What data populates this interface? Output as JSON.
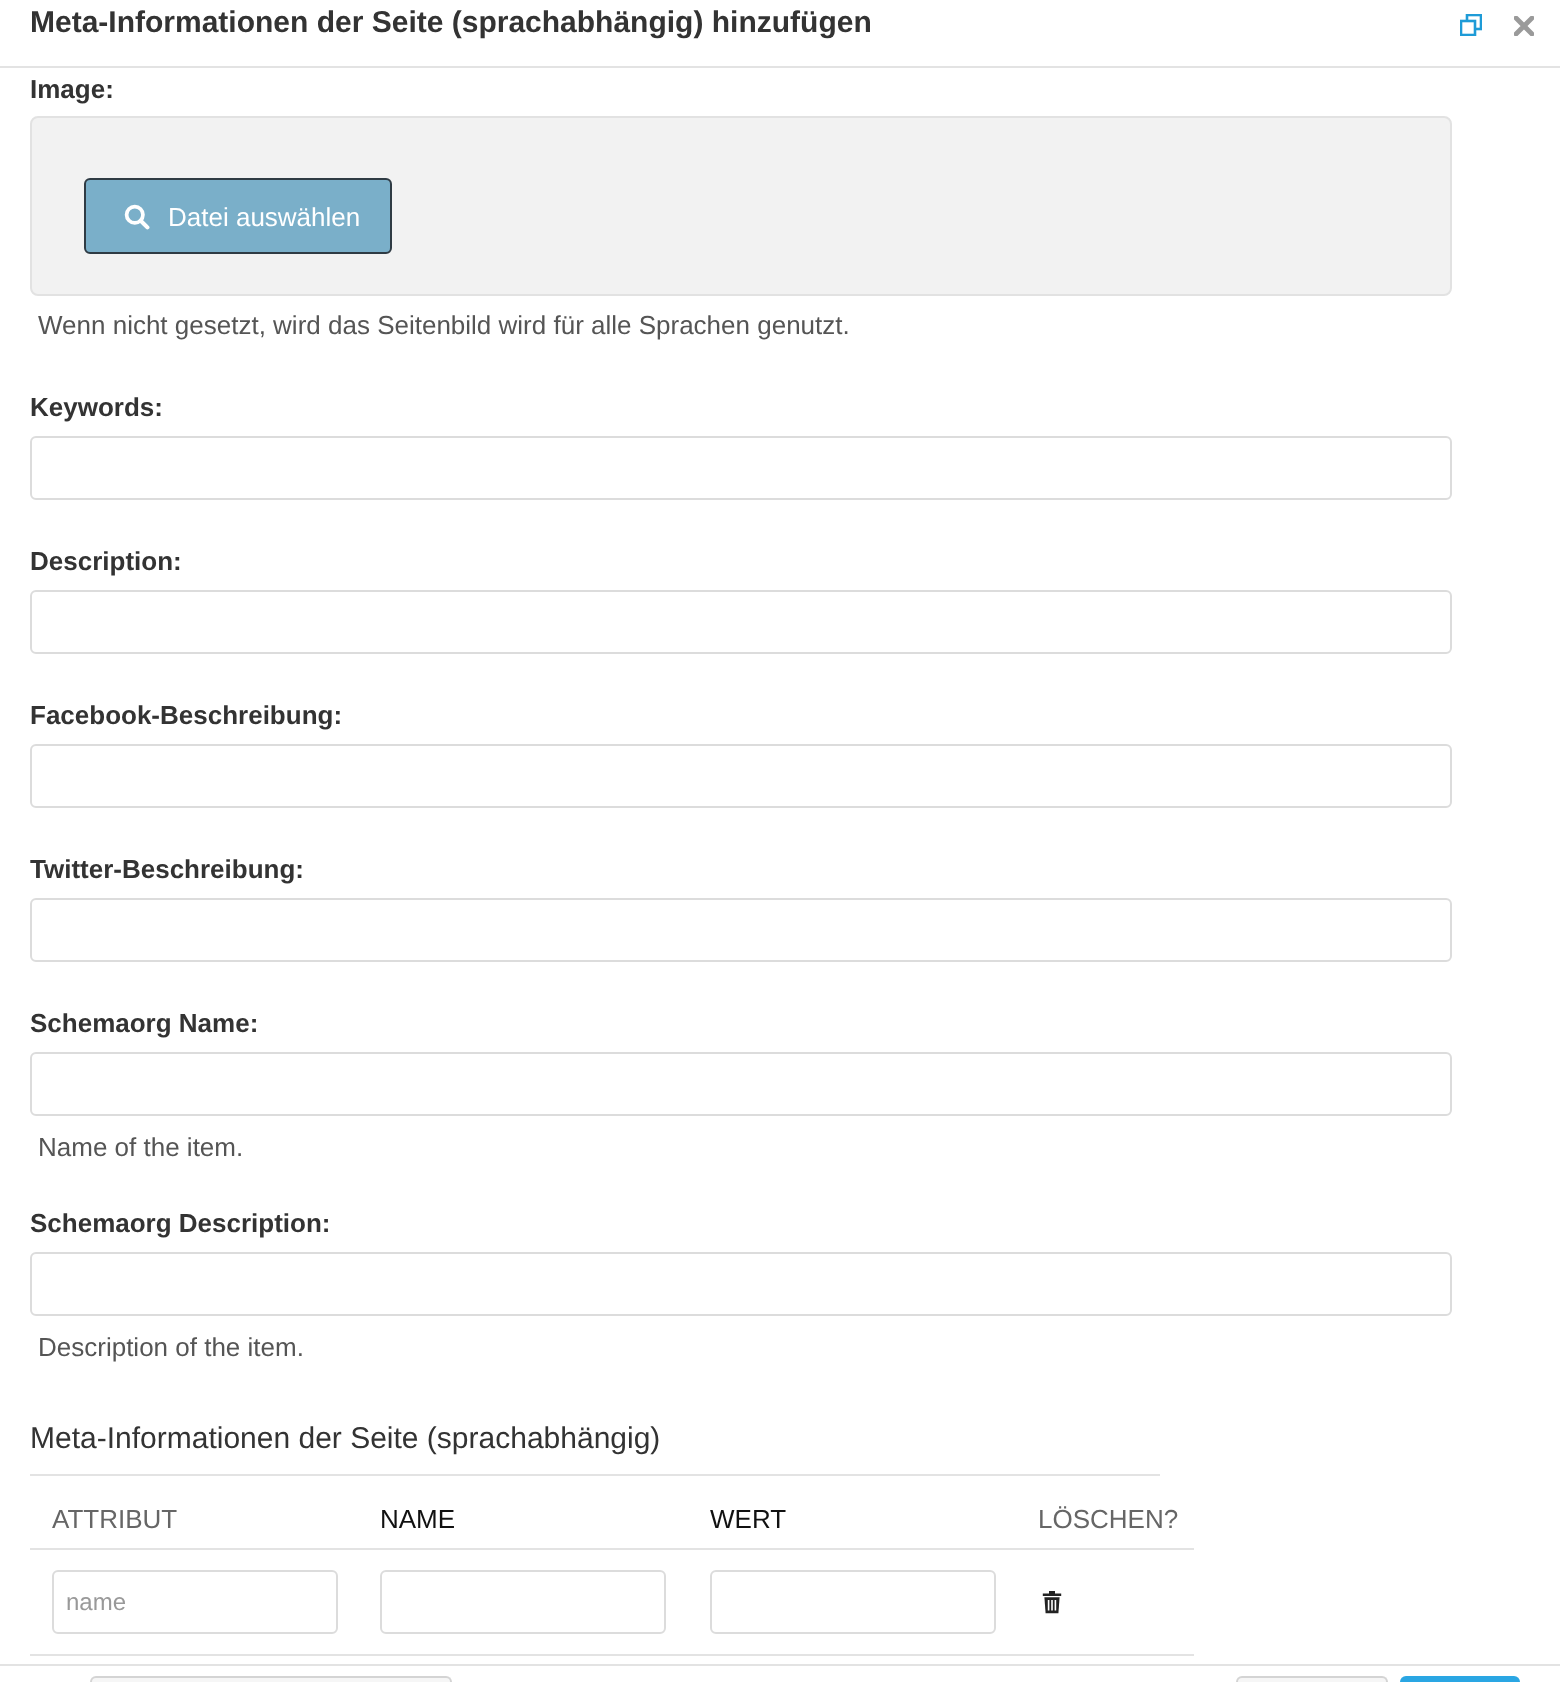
{
  "dialog": {
    "title": "Meta-Informationen der Seite (sprachabhängig) hinzufügen"
  },
  "fields": [
    {
      "kind": "image",
      "label": "Image:",
      "button": "Datei auswählen",
      "help": "Wenn nicht gesetzt, wird das Seitenbild wird für alle Sprachen genutzt."
    },
    {
      "kind": "text",
      "label": "Keywords:"
    },
    {
      "kind": "text",
      "label": "Description:"
    },
    {
      "kind": "text",
      "label": "Facebook-Beschreibung:"
    },
    {
      "kind": "text",
      "label": "Twitter-Beschreibung:"
    },
    {
      "kind": "text",
      "label": "Schemaorg Name:",
      "help": "Name of the item."
    },
    {
      "kind": "text",
      "label": "Schemaorg Description:",
      "help": "Description of the item."
    }
  ],
  "meta_table": {
    "heading": "Meta-Informationen der Seite (sprachabhängig)",
    "columns": [
      {
        "label": "ATTRIBUT",
        "muted": true
      },
      {
        "label": "NAME",
        "muted": false
      },
      {
        "label": "WERT",
        "muted": false
      },
      {
        "label": "LÖSCHEN?",
        "muted": true
      }
    ],
    "rows": [
      {
        "cells": [
          {
            "kind": "input",
            "placeholder": "name"
          },
          {
            "kind": "input"
          },
          {
            "kind": "input"
          },
          {
            "kind": "delete"
          }
        ]
      }
    ]
  },
  "footer": {
    "buttons": [
      {
        "kind": "default"
      },
      {
        "kind": "default"
      },
      {
        "kind": "primary"
      }
    ]
  }
}
